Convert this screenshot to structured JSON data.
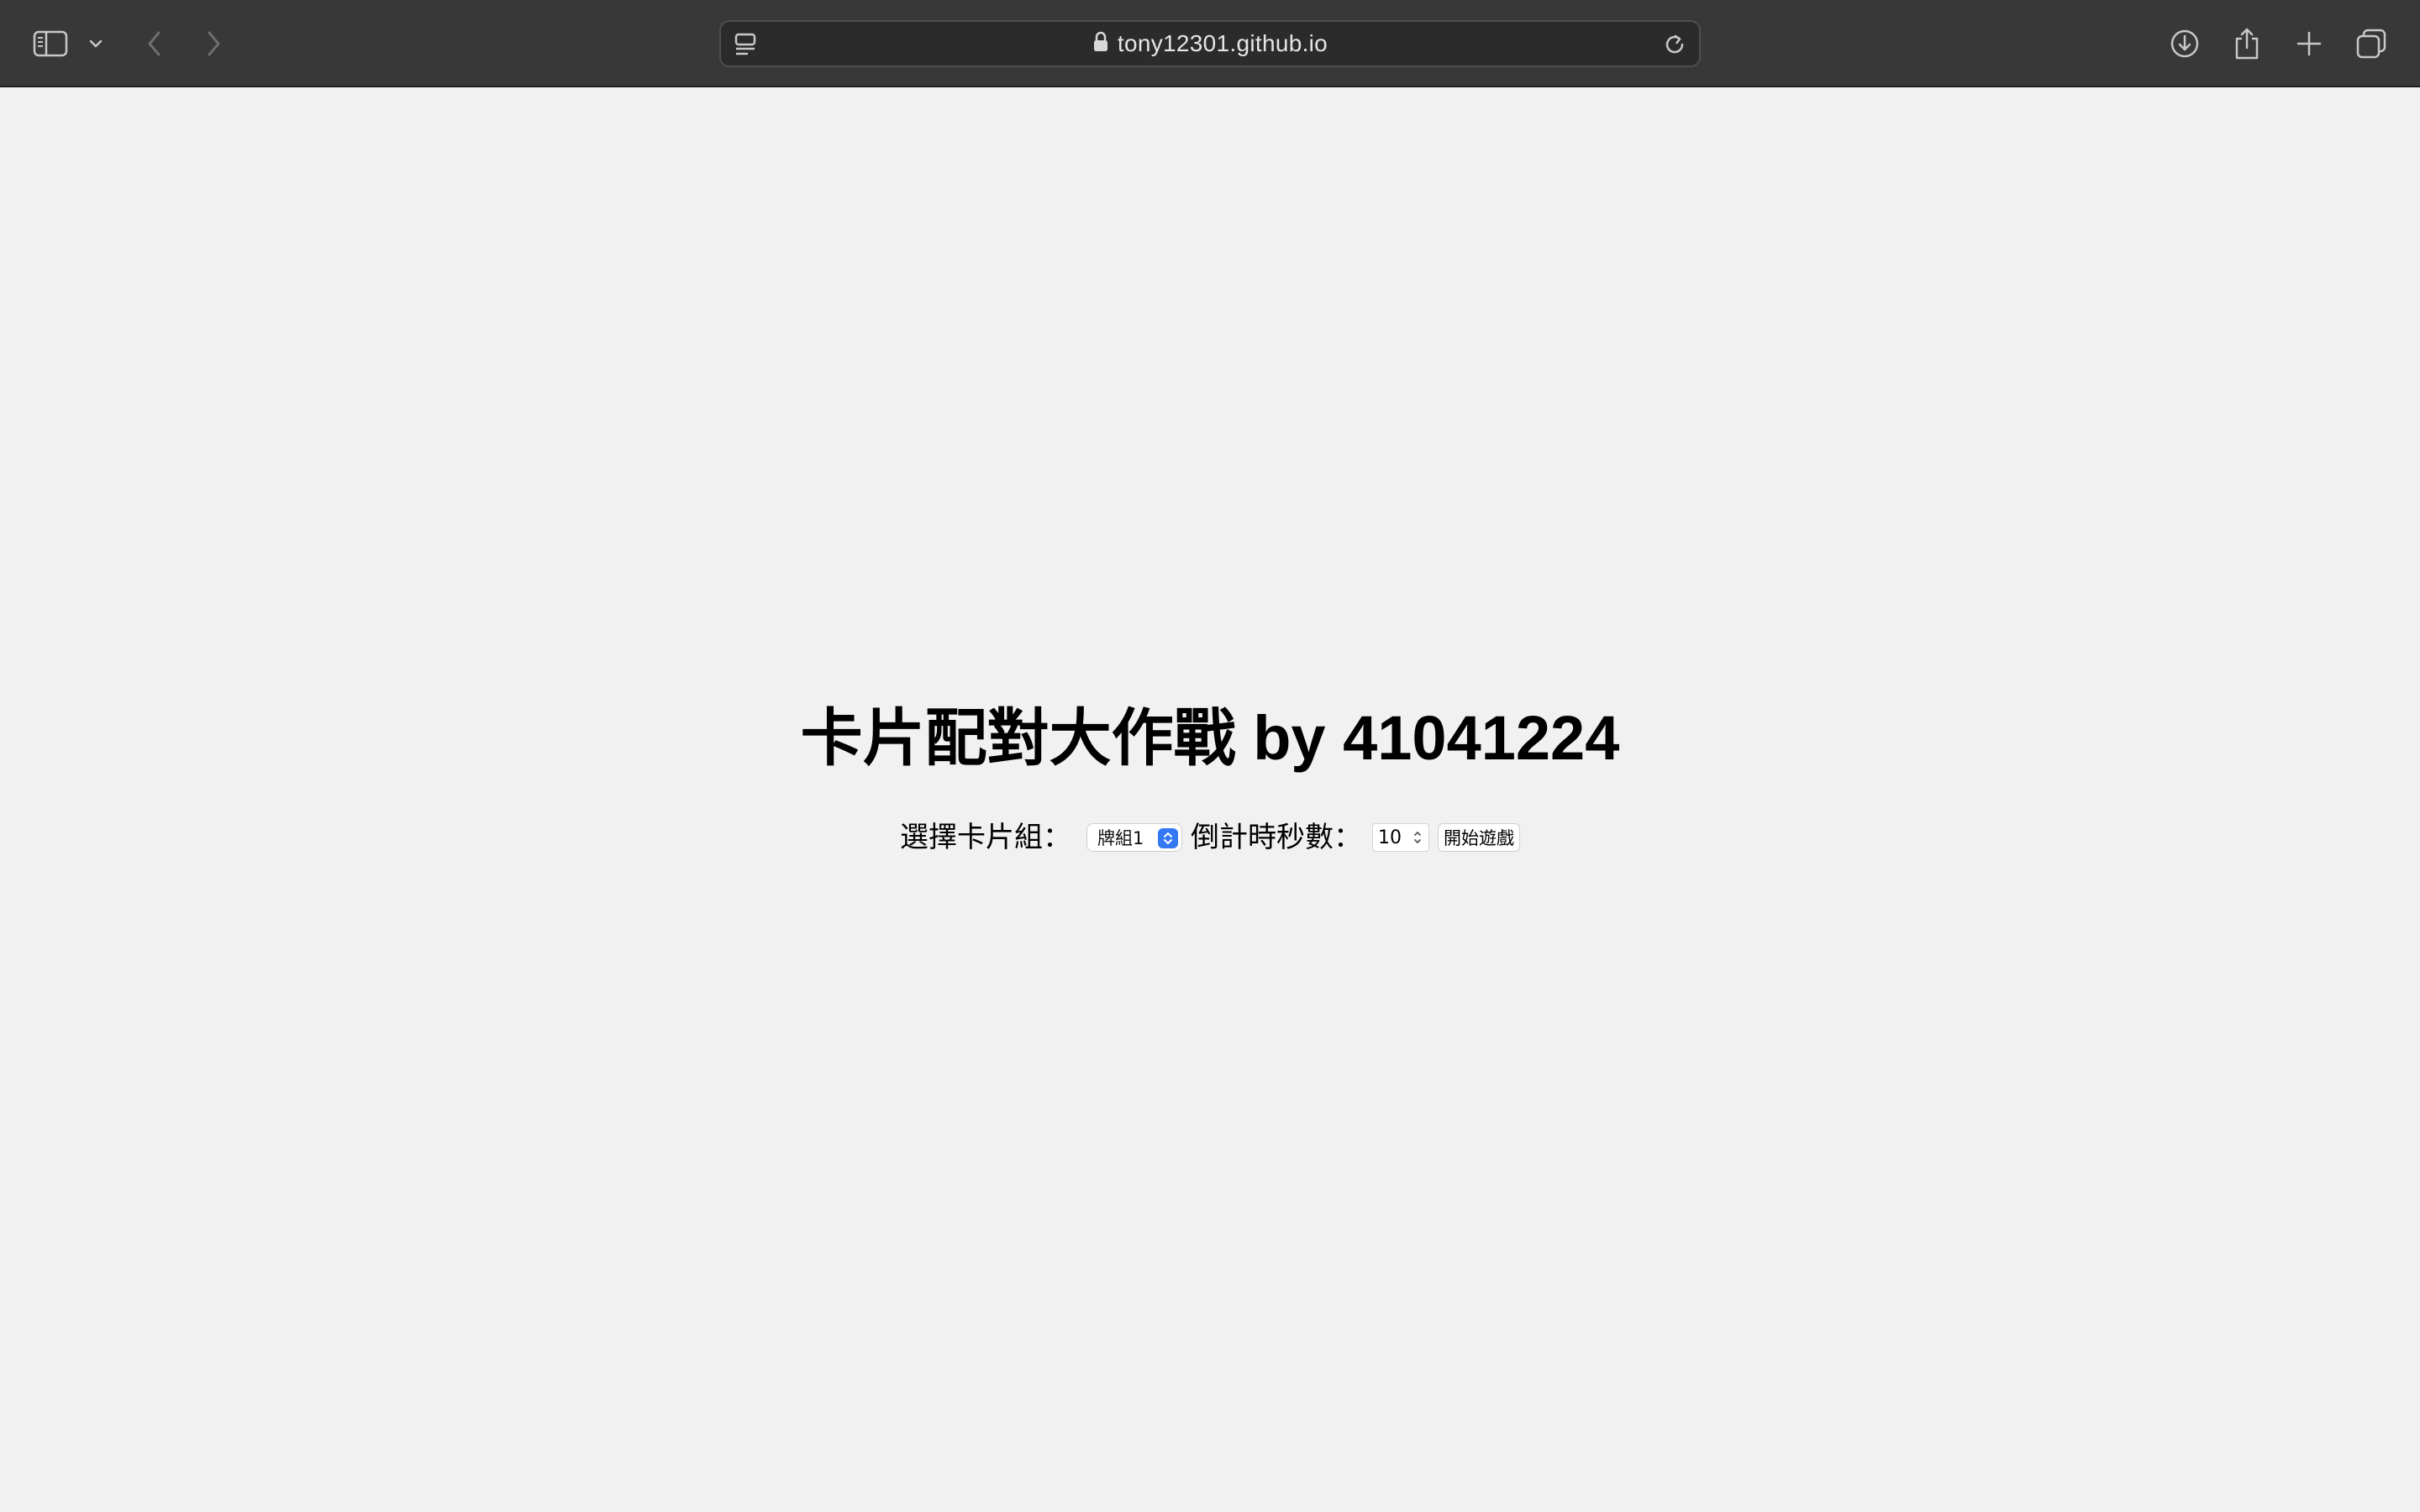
{
  "browser": {
    "url": "tony12301.github.io"
  },
  "page": {
    "title": "卡片配對大作戰 by 41041224",
    "deck_label": "選擇卡片組：",
    "deck_selected": "牌組1",
    "timer_label": "倒計時秒數：",
    "timer_value": "10",
    "start_button_label": "開始遊戲"
  }
}
